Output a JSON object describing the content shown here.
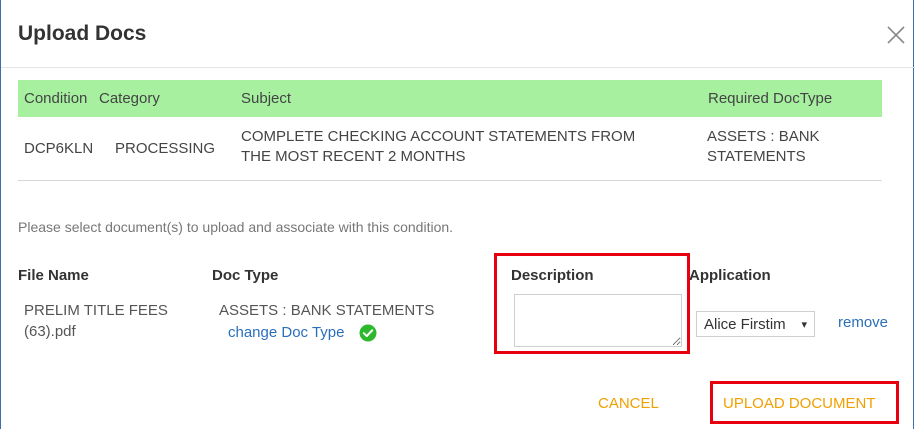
{
  "dialog": {
    "title": "Upload Docs",
    "close_icon": "close-icon"
  },
  "conditions_table": {
    "headers": {
      "condition": "Condition",
      "category": "Category",
      "subject": "Subject",
      "required_doctype": "Required DocType"
    },
    "row": {
      "condition": "DCP6KLN",
      "category": "PROCESSING",
      "subject_line1": "COMPLETE CHECKING ACCOUNT STATEMENTS FROM",
      "subject_line2": "THE MOST RECENT 2 MONTHS",
      "required_line1": "ASSETS : BANK",
      "required_line2": "STATEMENTS"
    }
  },
  "instructions": "Please select document(s) to upload and associate with this condition.",
  "files_table": {
    "headers": {
      "file_name": "File Name",
      "doc_type": "Doc Type",
      "description": "Description",
      "application": "Application"
    },
    "row": {
      "file_name_line1": "PRELIM TITLE FEES",
      "file_name_line2": "(63).pdf",
      "doc_type": "ASSETS : BANK STATEMENTS",
      "change_doc_type": "change Doc Type",
      "description_value": "",
      "application_selected": "Alice Firstim",
      "remove": "remove"
    }
  },
  "footer": {
    "cancel": "CANCEL",
    "upload": "UPLOAD DOCUMENT"
  },
  "colors": {
    "table_header_bg": "#a6f0a0",
    "link": "#2a6fbd",
    "action": "#f0a000",
    "highlight": "#e8000f",
    "check": "#2eb82e"
  }
}
